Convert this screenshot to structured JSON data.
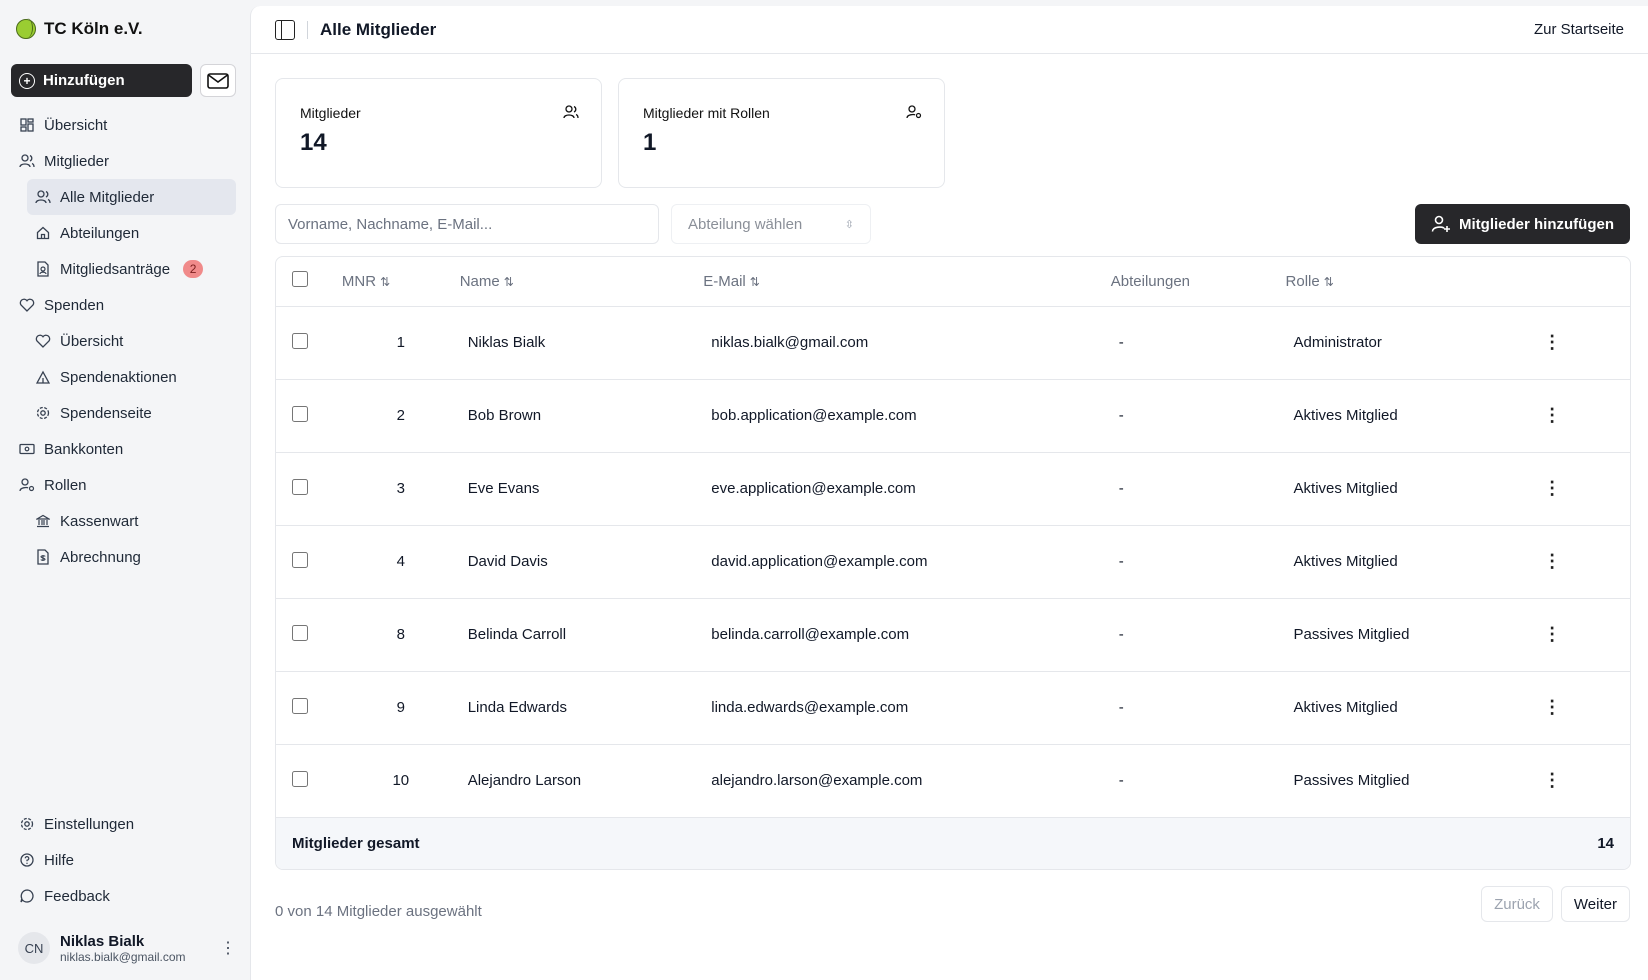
{
  "brand": {
    "name": "TC Köln e.V."
  },
  "sidebar": {
    "add_label": "Hinzufügen",
    "items": [
      {
        "label": "Übersicht"
      },
      {
        "label": "Mitglieder"
      },
      {
        "label": "Alle Mitglieder"
      },
      {
        "label": "Abteilungen"
      },
      {
        "label": "Mitgliedsanträge",
        "badge": "2"
      },
      {
        "label": "Spenden"
      },
      {
        "label": "Übersicht"
      },
      {
        "label": "Spendenaktionen"
      },
      {
        "label": "Spendenseite"
      },
      {
        "label": "Bankkonten"
      },
      {
        "label": "Rollen"
      },
      {
        "label": "Kassenwart"
      },
      {
        "label": "Abrechnung"
      }
    ],
    "bottom": [
      {
        "label": "Einstellungen"
      },
      {
        "label": "Hilfe"
      },
      {
        "label": "Feedback"
      }
    ],
    "user": {
      "initials": "CN",
      "name": "Niklas Bialk",
      "email": "niklas.bialk@gmail.com"
    }
  },
  "header": {
    "title": "Alle Mitglieder",
    "home_link": "Zur Startseite"
  },
  "stats": [
    {
      "label": "Mitglieder",
      "value": "14"
    },
    {
      "label": "Mitglieder mit Rollen",
      "value": "1"
    }
  ],
  "filters": {
    "search_placeholder": "Vorname, Nachname, E-Mail...",
    "department_placeholder": "Abteilung wählen",
    "add_members_label": "Mitglieder hinzufügen"
  },
  "table": {
    "columns": {
      "mnr": "MNR",
      "name": "Name",
      "email": "E-Mail",
      "departments": "Abteilungen",
      "role": "Rolle"
    },
    "rows": [
      {
        "mnr": "1",
        "name": "Niklas Bialk",
        "email": "niklas.bialk@gmail.com",
        "departments": "-",
        "role": "Administrator"
      },
      {
        "mnr": "2",
        "name": "Bob Brown",
        "email": "bob.application@example.com",
        "departments": "-",
        "role": "Aktives Mitglied"
      },
      {
        "mnr": "3",
        "name": "Eve Evans",
        "email": "eve.application@example.com",
        "departments": "-",
        "role": "Aktives Mitglied"
      },
      {
        "mnr": "4",
        "name": "David Davis",
        "email": "david.application@example.com",
        "departments": "-",
        "role": "Aktives Mitglied"
      },
      {
        "mnr": "8",
        "name": "Belinda Carroll",
        "email": "belinda.carroll@example.com",
        "departments": "-",
        "role": "Passives Mitglied"
      },
      {
        "mnr": "9",
        "name": "Linda Edwards",
        "email": "linda.edwards@example.com",
        "departments": "-",
        "role": "Aktives Mitglied"
      },
      {
        "mnr": "10",
        "name": "Alejandro Larson",
        "email": "alejandro.larson@example.com",
        "departments": "-",
        "role": "Passives Mitglied"
      }
    ],
    "footer": {
      "label": "Mitglieder gesamt",
      "total": "14"
    }
  },
  "selection": {
    "text": "0 von 14 Mitglieder ausgewählt"
  },
  "pagination": {
    "prev": "Zurück",
    "next": "Weiter"
  }
}
